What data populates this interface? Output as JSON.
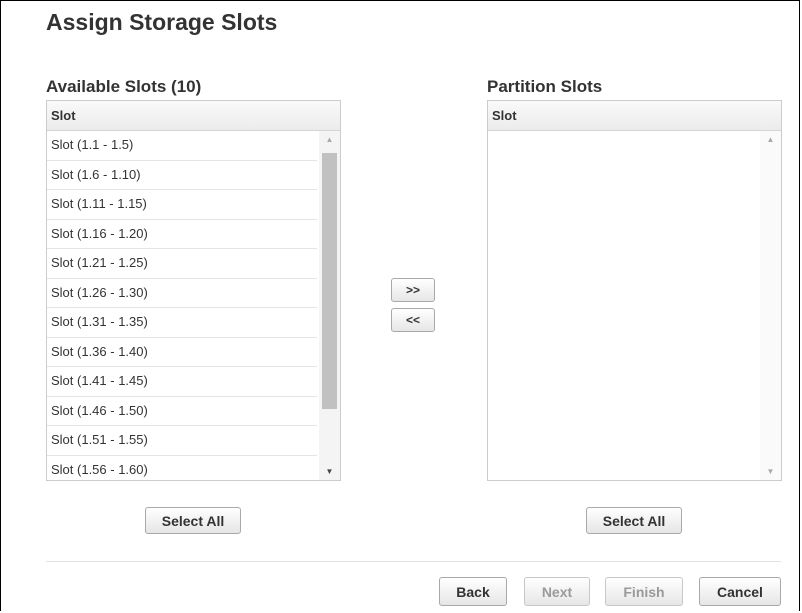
{
  "page": {
    "title": "Assign Storage Slots"
  },
  "available": {
    "label": "Available Slots (10)",
    "column_header": "Slot",
    "rows": [
      "Slot (1.1 - 1.5)",
      "Slot (1.6 - 1.10)",
      "Slot (1.11 - 1.15)",
      "Slot (1.16 - 1.20)",
      "Slot (1.21 - 1.25)",
      "Slot (1.26 - 1.30)",
      "Slot (1.31 - 1.35)",
      "Slot (1.36 - 1.40)",
      "Slot (1.41 - 1.45)",
      "Slot (1.46 - 1.50)",
      "Slot (1.51 - 1.55)",
      "Slot (1.56 - 1.60)"
    ],
    "select_all_label": "Select All",
    "scroll_up_icon": "triangle-up-icon",
    "scroll_down_icon": "triangle-down-icon"
  },
  "partition": {
    "label": "Partition Slots",
    "column_header": "Slot",
    "rows": [],
    "select_all_label": "Select All"
  },
  "transfer": {
    "add_label": ">>",
    "remove_label": "<<"
  },
  "footer": {
    "back_label": "Back",
    "next_label": "Next",
    "finish_label": "Finish",
    "cancel_label": "Cancel"
  },
  "colors": {
    "scroll_arrow_active": "#444444",
    "scroll_arrow_inactive": "#a9a9a9",
    "scroll_thumb": "#c1c1c1",
    "disabled_text": "#9a9a9a"
  }
}
